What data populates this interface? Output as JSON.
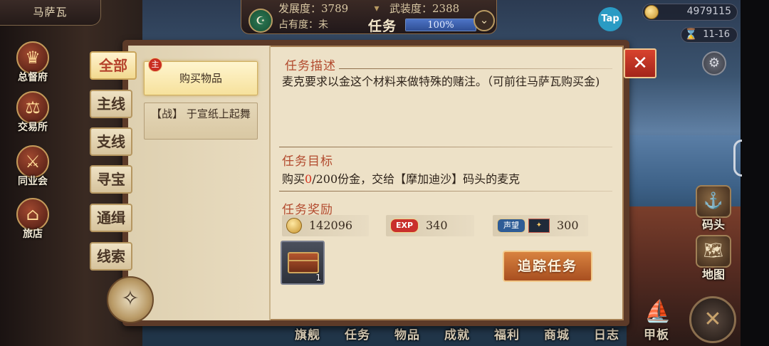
{
  "city": "马萨瓦",
  "stats": {
    "development": "发展度：3789",
    "armament": "武装度：2388",
    "occupancy": "占有度：未"
  },
  "header": {
    "title": "任务",
    "progress_text": "100%",
    "progress_value": 1.0
  },
  "tap_label": "Tap",
  "money": "4979115",
  "date": "11-16",
  "buildings": [
    {
      "label": "总督府",
      "icon": "crown-icon"
    },
    {
      "label": "交易所",
      "icon": "scales-icon"
    },
    {
      "label": "同业会",
      "icon": "guild-shield-icon"
    },
    {
      "label": "旅店",
      "icon": "inn-icon"
    }
  ],
  "side_nav": [
    {
      "label": "码头",
      "icon": "dock-icon"
    },
    {
      "label": "地图",
      "icon": "map-scroll-icon"
    }
  ],
  "bottom_menu": [
    "旗舰",
    "任务",
    "物品",
    "成就",
    "福利",
    "商城",
    "日志",
    "甲板"
  ],
  "categories": [
    "全部",
    "主线",
    "支线",
    "寻宝",
    "通缉",
    "线索"
  ],
  "active_category": "全部",
  "quests": [
    {
      "badge": "主",
      "title": "购买物品",
      "selected": true
    },
    {
      "title": "【战】 于宣纸上起舞",
      "selected": false
    }
  ],
  "detail": {
    "desc_title": "任务描述",
    "desc_text": "麦克要求以金这个材料来做特殊的赌注。（可前往马萨瓦购买金)",
    "goal_title": "任务目标",
    "goal_prefix": "购买",
    "goal_current": "0",
    "goal_suffix": "/200份金，交给【摩加迪沙】码头的麦克",
    "reward_title": "任务奖励",
    "rewards": {
      "gold": "142096",
      "exp_label": "EXP",
      "exp": "340",
      "reputation_label": "声望",
      "reputation": "300"
    },
    "item_qty": "1",
    "track_button": "追踪任务"
  },
  "colors": {
    "accent_red": "#d6341f",
    "section_title": "#b24a2e",
    "track_button": "#c0642d"
  }
}
